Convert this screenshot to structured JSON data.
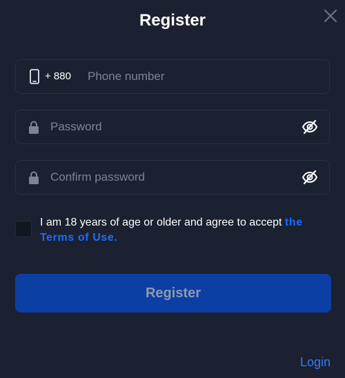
{
  "modal": {
    "title": "Register",
    "close_icon": "close-icon"
  },
  "phone": {
    "icon": "phone-icon",
    "country_code": "+ 880",
    "placeholder": "Phone number",
    "value": ""
  },
  "password": {
    "icon": "lock-icon",
    "placeholder": "Password",
    "value": "",
    "toggle_icon": "eye-off-icon"
  },
  "confirm_password": {
    "icon": "lock-icon",
    "placeholder": "Confirm password",
    "value": "",
    "toggle_icon": "eye-off-icon"
  },
  "terms": {
    "checked": false,
    "text": "I am 18 years of age or older and agree to accept ",
    "link_text": "the Terms of Use."
  },
  "actions": {
    "register_label": "Register",
    "login_label": "Login"
  },
  "colors": {
    "background": "#1b2131",
    "field_border": "#2a3143",
    "button": "#0c3fa3",
    "button_text": "#8e98ae",
    "link": "#1a6dff",
    "login_link": "#2f7cf6",
    "placeholder": "#7d8494"
  }
}
